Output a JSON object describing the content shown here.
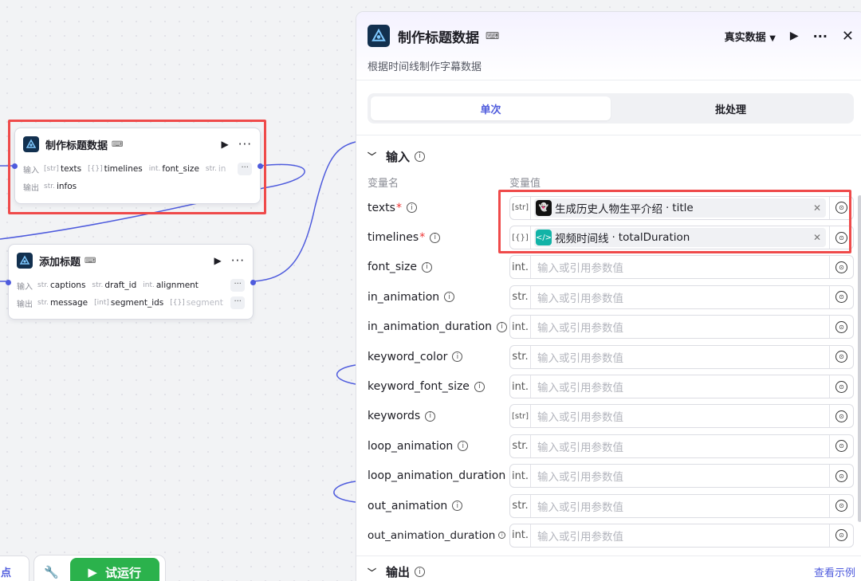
{
  "colors": {
    "accent": "#4e5bdd",
    "highlight": "#ef4a4a",
    "run_button": "#2bb24c",
    "wire": "#4e5bdd"
  },
  "canvas": {
    "node_make": {
      "title": "制作标题数据",
      "input_label": "输入",
      "output_label": "输出",
      "inputs": [
        {
          "type": "[str]",
          "name": "texts"
        },
        {
          "type": "[{}]",
          "name": "timelines"
        },
        {
          "type": "int.",
          "name": "font_size"
        },
        {
          "type": "str.",
          "name": "in"
        }
      ],
      "outputs": [
        {
          "type": "str.",
          "name": "infos"
        }
      ],
      "more": "···"
    },
    "node_add": {
      "title": "添加标题",
      "input_label": "输入",
      "output_label": "输出",
      "inputs": [
        {
          "type": "str.",
          "name": "captions"
        },
        {
          "type": "str.",
          "name": "draft_id"
        },
        {
          "type": "int.",
          "name": "alignment"
        }
      ],
      "outputs": [
        {
          "type": "str.",
          "name": "message"
        },
        {
          "type": "[int]",
          "name": "segment_ids"
        },
        {
          "type": "[{}]",
          "name": "segment"
        }
      ],
      "more": "···"
    }
  },
  "toolbar": {
    "left_label": "点",
    "run_label": "试运行"
  },
  "panel": {
    "title": "制作标题数据",
    "description": "根据时间线制作字幕数据",
    "data_mode": "真实数据",
    "tabs": [
      "单次",
      "批处理"
    ],
    "active_tab": "单次",
    "input_section": "输入",
    "col_name": "变量名",
    "col_value": "变量值",
    "placeholder": "输入或引用参数值",
    "fields": [
      {
        "name": "texts",
        "required": "*",
        "type": "[str]",
        "ref_source": "生成历史人物生平介绍",
        "ref_field": "title",
        "ref_icon": "bot-icon"
      },
      {
        "name": "timelines",
        "required": "*",
        "type": "[{}]",
        "ref_source": "视频时间线",
        "ref_field": "totalDuration",
        "ref_icon": "code-icon"
      },
      {
        "name": "font_size",
        "type": "int."
      },
      {
        "name": "in_animation",
        "type": "str."
      },
      {
        "name": "in_animation_duration",
        "type": "int."
      },
      {
        "name": "keyword_color",
        "type": "str."
      },
      {
        "name": "keyword_font_size",
        "type": "int."
      },
      {
        "name": "keywords",
        "type": "[str]"
      },
      {
        "name": "loop_animation",
        "type": "str."
      },
      {
        "name": "loop_animation_duration",
        "type": "int."
      },
      {
        "name": "out_animation",
        "type": "str."
      },
      {
        "name": "out_animation_duration",
        "type": "int."
      }
    ],
    "output_section": "输出",
    "view_example": "查看示例"
  }
}
